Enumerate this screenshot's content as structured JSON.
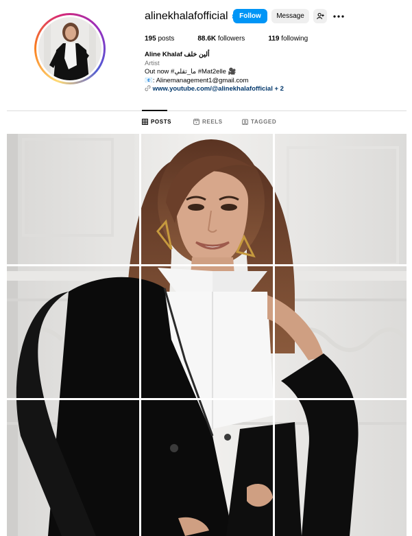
{
  "profile": {
    "username": "alinekhalafofficial",
    "follow_label": "Follow",
    "message_label": "Message",
    "more_label": "•••",
    "stats": {
      "posts": "195",
      "posts_label": " posts",
      "followers": "88.6K",
      "followers_label": " followers",
      "following": "119",
      "following_label": " following"
    },
    "bio": {
      "name": "Aline Khalaf",
      "name_arabic": "ألين خلف",
      "category": "Artist",
      "line1": "Out now #ما_تقلي #Mat2elle 🎥",
      "line2": "📧: Alinemanagement1@gmail.com",
      "link": "www.youtube.com/@alinekhalafofficial",
      "link_extra": " + 2"
    }
  },
  "tabs": [
    {
      "label": "POSTS",
      "active": true,
      "icon": "grid-icon"
    },
    {
      "label": "REELS",
      "active": false,
      "icon": "reels-icon"
    },
    {
      "label": "TAGGED",
      "active": false,
      "icon": "tagged-icon"
    }
  ],
  "colors": {
    "accent": "#0095f6",
    "link": "#00376b",
    "muted": "#737373",
    "divider": "#dbdbdb"
  }
}
